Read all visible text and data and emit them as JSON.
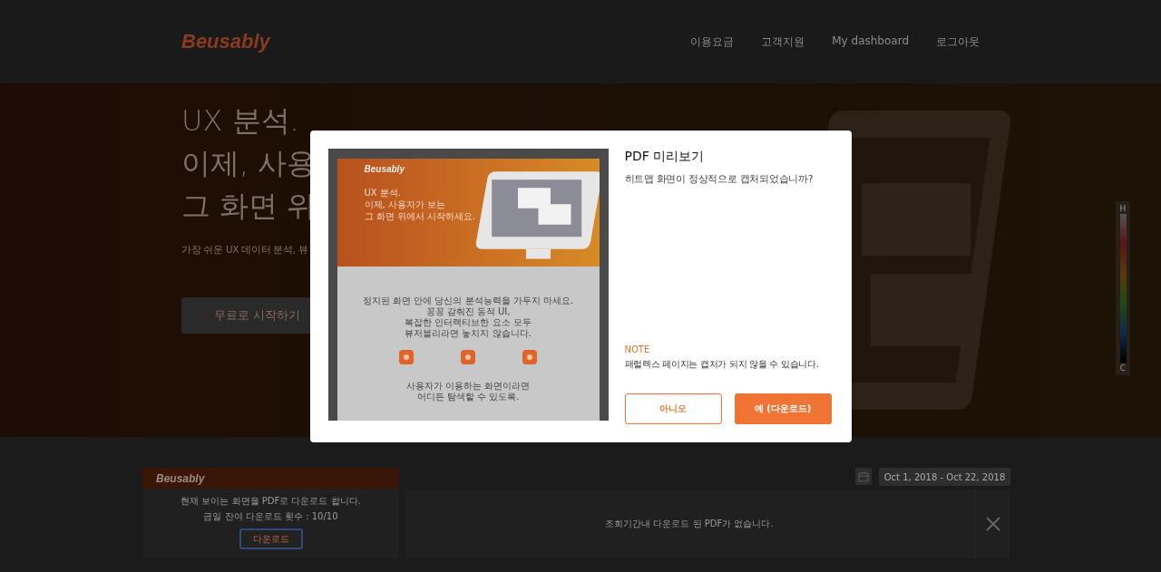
{
  "header": {
    "logo": "Beusably",
    "nav": [
      "이용요금",
      "고객지원",
      "My dashboard",
      "로그아웃"
    ]
  },
  "hero": {
    "lines": [
      "UX 분석.",
      "이제, 사용",
      "그 화면 위"
    ],
    "subtitle": "가장 쉬운 UX 데이터 분석, 뷰",
    "cta": "무료로 시작하기",
    "legend": {
      "top": "H",
      "bottom": "C"
    }
  },
  "pdf_card": {
    "logo": "Beusably",
    "message": "현재 보이는 화면을 PDF로 다운로드 합니다.",
    "remaining": "금일 잔여 다운로드 횟수 : 10/10",
    "button": "다운로드"
  },
  "date_range": "Oct 1, 2018 - Oct 22, 2018",
  "history": {
    "empty_message": "조회기간내 다운로드 된 PDF가 없습니다."
  },
  "modal": {
    "title": "PDF 미리보기",
    "question": "히트맵 화면이 정상적으로 캡처되었습니까?",
    "preview": {
      "logo": "Beusably",
      "hero_lines": [
        "UX 분석.",
        "이제, 사용자가 보는",
        "그 화면 위에서 시작하세요."
      ],
      "body_lines": [
        "정지된 화면 안에 당신의 분석능력을 가두지 마세요.",
        "꽁꽁 감춰진 동적 UI,",
        "복잡한 인터랙티브한 요소 모두",
        "뷰저블리라면 놓치지 않습니다."
      ],
      "footer_lines": [
        "사용자가 이용하는 화면이라면",
        "어디든 탐색할 수 있도록."
      ]
    },
    "note_label": "NOTE",
    "note": "패럴렉스 페이지는 캡처가 되지 않을 수 있습니다.",
    "buttons": [
      {
        "label": "아니오",
        "kind": "secondary"
      },
      {
        "label": "예 (다운로드)",
        "kind": "primary"
      }
    ]
  }
}
